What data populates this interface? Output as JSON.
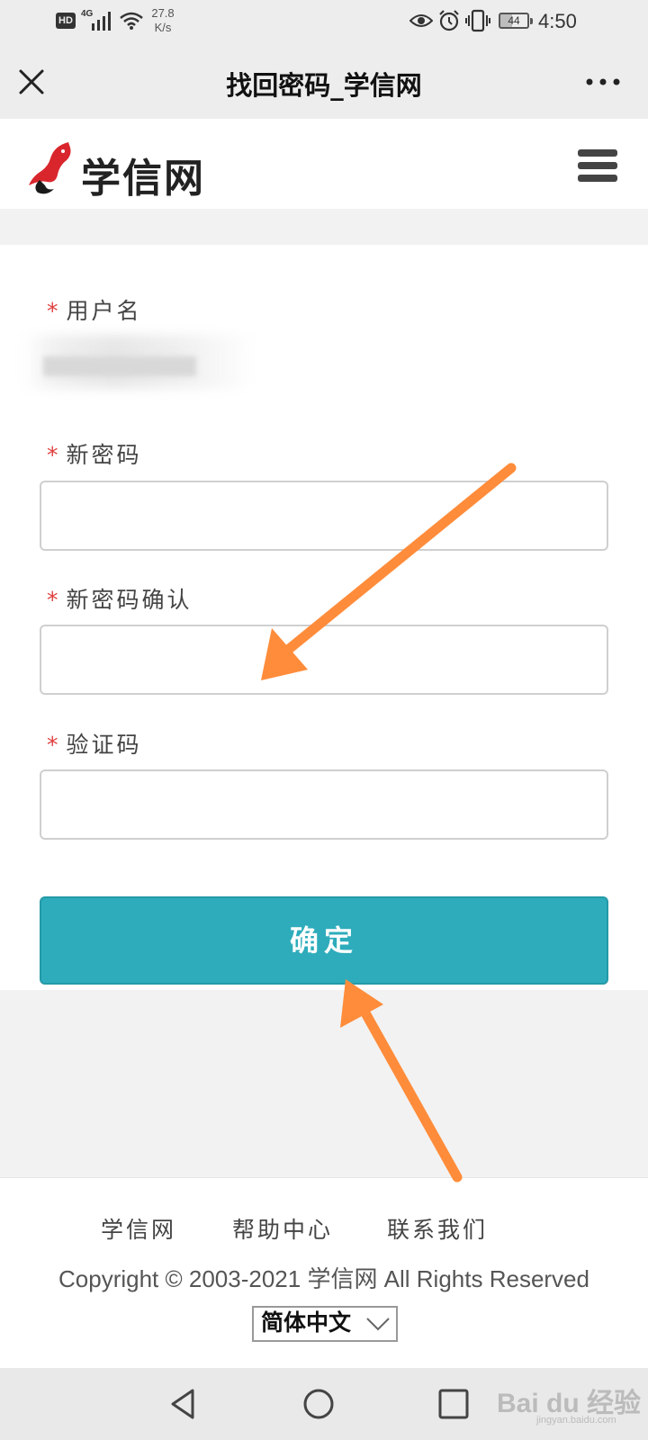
{
  "status_bar": {
    "hd": "HD",
    "network": "4G",
    "speed_value": "27.8",
    "speed_unit": "K/s",
    "battery": "44",
    "time": "4:50"
  },
  "title_bar": {
    "title": "找回密码_学信网"
  },
  "site_header": {
    "logo_text": "学信网",
    "brand_color": "#d9262d"
  },
  "form": {
    "username_label": "用户名",
    "new_password_label": "新密码",
    "confirm_password_label": "新密码确认",
    "captcha_label": "验证码",
    "required_mark": "*",
    "submit_label": "确定",
    "accent_color": "#2eacbb"
  },
  "footer": {
    "links": [
      "学信网",
      "帮助中心",
      "联系我们"
    ],
    "copyright": "Copyright © 2003-2021 学信网 All Rights Reserved",
    "language_selected": "简体中文"
  },
  "watermark": {
    "text": "Bai du 经验",
    "sub": "jingyan.baidu.com"
  },
  "annotation_color": "#ff8c3a"
}
